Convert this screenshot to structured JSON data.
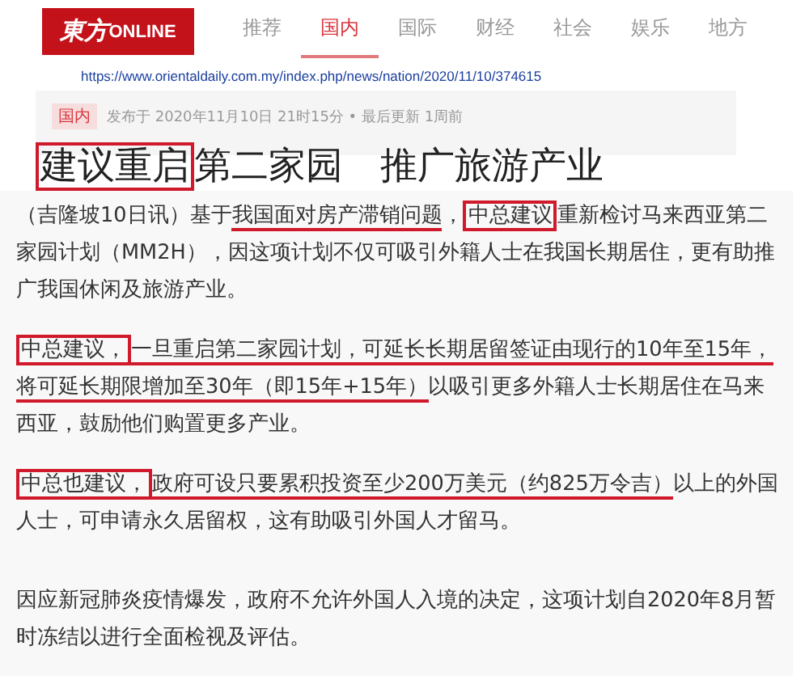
{
  "logo": {
    "text": "東方",
    "suffix": "ONLINE"
  },
  "nav": [
    {
      "label": "推荐",
      "selected": false
    },
    {
      "label": "国内",
      "selected": true
    },
    {
      "label": "国际",
      "selected": false
    },
    {
      "label": "财经",
      "selected": false
    },
    {
      "label": "社会",
      "selected": false
    },
    {
      "label": "娱乐",
      "selected": false
    },
    {
      "label": "地方",
      "selected": false
    }
  ],
  "url": "https://www.orientaldaily.com.my/index.php/news/nation/2020/11/10/374615",
  "article": {
    "tag": "国内",
    "meta": "发布于 2020年11月10日 21时15分 • 最后更新 1周前",
    "title": [
      {
        "kind": "boxed",
        "text": "建议重启"
      },
      {
        "kind": "plain",
        "text": "第二家园　推广旅游产业"
      }
    ],
    "paragraphs": [
      [
        {
          "kind": "plain",
          "text": "（吉隆坡10日讯）基于"
        },
        {
          "kind": "underlined",
          "text": "我国面对房产滞销问题"
        },
        {
          "kind": "plain",
          "text": "，"
        },
        {
          "kind": "boxed",
          "text": "中总建议"
        },
        {
          "kind": "plain",
          "text": "重新检讨马来西亚第二家园计划（MM2H），因这项计划不仅可吸引外籍人士在我国长期居住，更有助推广我国休闲及旅游产业。"
        }
      ],
      [
        {
          "kind": "boxed",
          "text": "中总建议，"
        },
        {
          "kind": "underlined",
          "text": "一旦重启第二家园计划，可延长长期居留签证由现行的10年至15年，将可延长期限增加至30年（即15年+15年）"
        },
        {
          "kind": "plain",
          "text": "以吸引更多外籍人士长期居住在马来西亚，鼓励他们购置更多产业。"
        }
      ],
      [
        {
          "kind": "boxed",
          "text": "中总也建议，"
        },
        {
          "kind": "underlined",
          "text": "政府可设只要累积投资至少200万美元（约825万令吉）"
        },
        {
          "kind": "plain",
          "text": "以上的外国人士，可申请永久居留权，这有助吸引外国人才留马。"
        }
      ],
      [
        {
          "kind": "plain",
          "text": "因应新冠肺炎疫情爆发，政府不允许外国人入境的决定，这项计划自2020年8月暂时冻结以进行全面检视及评估。"
        }
      ]
    ]
  }
}
